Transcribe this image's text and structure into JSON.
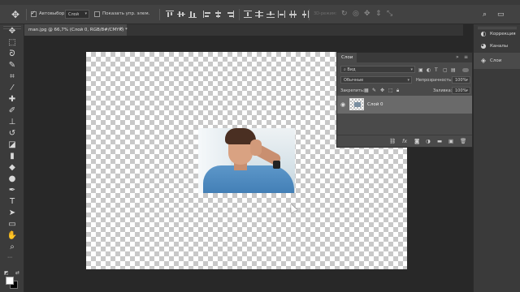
{
  "options_bar": {
    "autoselect_label": "Автовыбор:",
    "autoselect_value": "Слой",
    "show_controls_label": "Показать упр. элем.",
    "mode3d_label": "3D-режим:"
  },
  "document": {
    "tab_title": "man.jpg @ 66,7% (Слой 0, RGB/8#/CMYK) *"
  },
  "layers_panel": {
    "title": "Слои",
    "filter_kind": "Вид",
    "blend_mode": "Обычные",
    "opacity_label": "Непрозрачность:",
    "opacity_value": "100%",
    "lock_label": "Закрепить:",
    "fill_label": "Заливка:",
    "fill_value": "100%",
    "layers": [
      {
        "name": "Слой 0",
        "visible": true,
        "selected": true
      }
    ],
    "footer_icons": [
      "link-icon",
      "fx-icon",
      "mask-icon",
      "adjustment-icon",
      "folder-icon",
      "new-layer-icon",
      "trash-icon"
    ]
  },
  "dock": {
    "items": [
      {
        "label": "Коррекция",
        "icon": "adjustments-icon"
      },
      {
        "label": "Каналы",
        "icon": "channels-icon"
      },
      {
        "label": "Слои",
        "icon": "layers-icon"
      }
    ]
  },
  "colors": {
    "ui_bg": "#282828",
    "panel_bg": "#4a4a4a",
    "selected_layer": "#6a6a6a"
  }
}
